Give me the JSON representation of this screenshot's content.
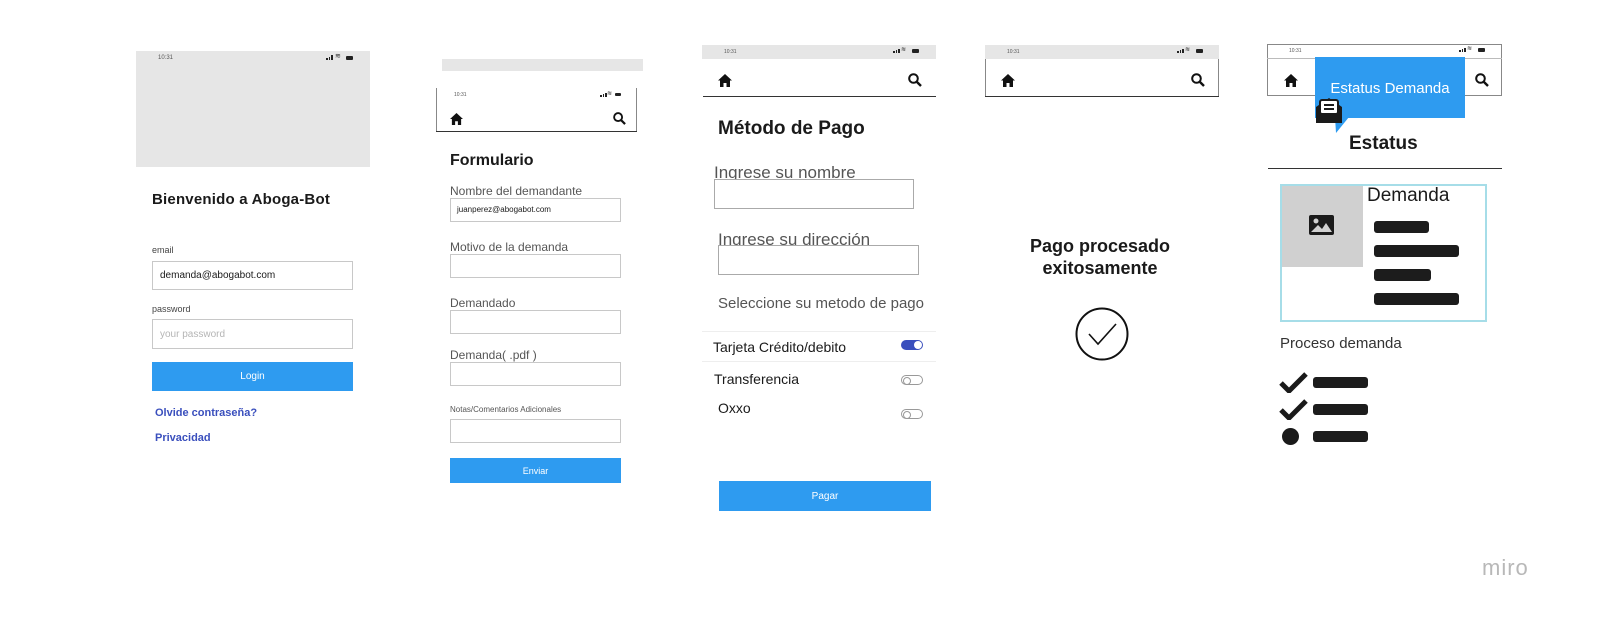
{
  "status": {
    "time": "10:31"
  },
  "login": {
    "title": "Bienvenido a Aboga-Bot",
    "email_label": "email",
    "email_value": "demanda@abogabot.com",
    "password_label": "password",
    "password_placeholder": "your password",
    "login_button": "Login",
    "forgot_link": "Olvide contraseña?",
    "privacy_link": "Privacidad"
  },
  "form": {
    "title": "Formulario",
    "plaintiff_label": "Nombre del demandante",
    "plaintiff_value": "juanperez@abogabot.com",
    "reason_label": "Motivo de la demanda",
    "defendant_label": "Demandado",
    "pdf_label": "Demanda( .pdf )",
    "notes_label": "Notas/Comentarios Adicionales",
    "submit_button": "Enviar"
  },
  "payment": {
    "title": "Método de Pago",
    "name_label": "Ingrese su nombre",
    "address_label": "Ingrese su dirección",
    "method_prompt": "Seleccione su metodo de pago",
    "methods": [
      {
        "label": "Tarjeta Crédito/debito",
        "on": true
      },
      {
        "label": "Transferencia",
        "on": false
      },
      {
        "label": "Oxxo",
        "on": false
      }
    ],
    "pay_button": "Pagar"
  },
  "success": {
    "message_line1": "Pago procesado",
    "message_line2": "exitosamente"
  },
  "status_screen": {
    "tooltip": "Estatus Demanda",
    "title": "Estatus",
    "card_title": "Demanda",
    "process_label": "Proceso demanda",
    "steps": [
      {
        "state": "done"
      },
      {
        "state": "done"
      },
      {
        "state": "current"
      }
    ]
  },
  "watermark": "miro",
  "colors": {
    "accent": "#2e9bf0",
    "link": "#3a4fbd",
    "toggle_on": "#3a4fbd",
    "card_border": "#a6dde8"
  }
}
